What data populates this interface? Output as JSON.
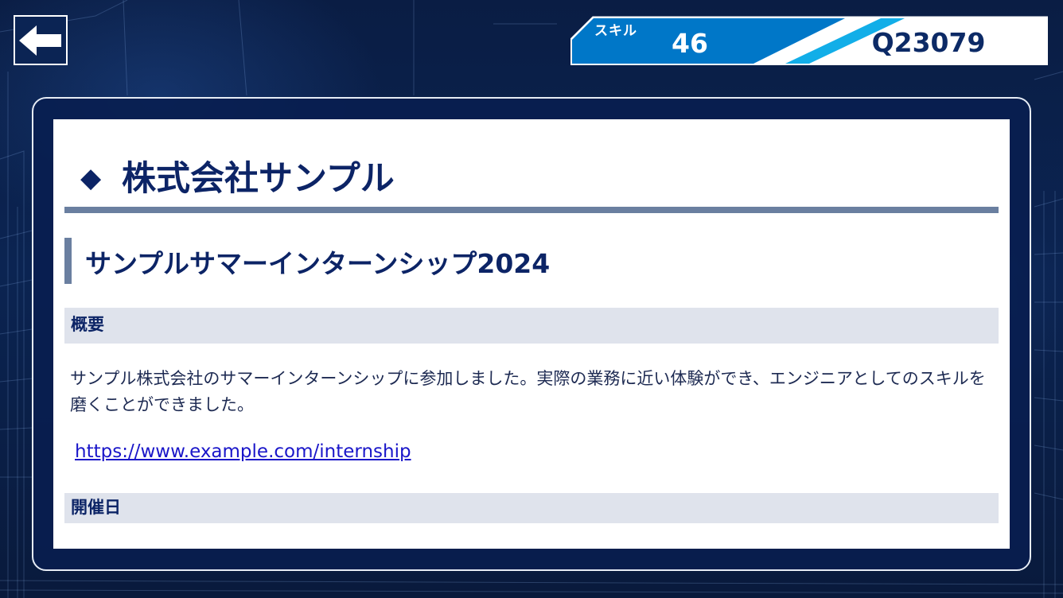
{
  "header": {
    "back_icon": "arrow-left-icon",
    "skill_label": "スキル",
    "skill_value": "46",
    "user_id": "Q23079"
  },
  "company": {
    "marker": "◆",
    "name": "株式会社サンプル"
  },
  "event": {
    "title": "サンプルサマーインターンシップ2024",
    "overview_heading": "概要",
    "description": "サンプル株式会社のサマーインターンシップに参加しました。実際の業務に近い体験ができ、エンジニアとしてのスキルを磨くことができました。",
    "link": "https://www.example.com/internship",
    "date_heading": "開催日"
  },
  "colors": {
    "navy": "#0c2466",
    "skill_blue": "#0077c8",
    "accent_cyan": "#12aee8",
    "rule_gray": "#6a7fa0",
    "section_bg": "#dfe3ec",
    "link": "#1a16c9"
  }
}
